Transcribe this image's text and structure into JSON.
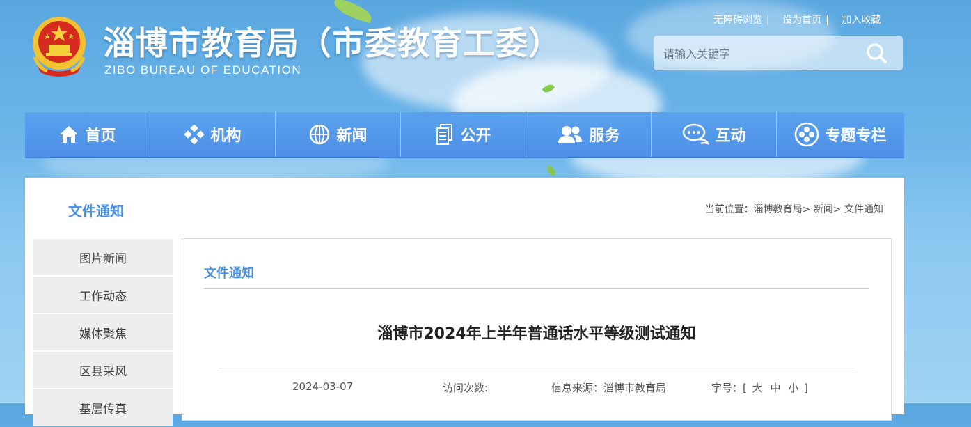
{
  "header": {
    "title": "淄博市教育局（市委教育工委）",
    "subtitle": "ZIBO BUREAU OF EDUCATION",
    "top_links": [
      "无障碍浏览",
      "设为首页",
      "加入收藏"
    ],
    "search_placeholder": "请输入关键字"
  },
  "nav": {
    "items": [
      {
        "label": "首页",
        "icon": "home-icon"
      },
      {
        "label": "机构",
        "icon": "organization-icon"
      },
      {
        "label": "新闻",
        "icon": "globe-icon"
      },
      {
        "label": "公开",
        "icon": "documents-icon"
      },
      {
        "label": "服务",
        "icon": "users-icon"
      },
      {
        "label": "互动",
        "icon": "chat-icon"
      },
      {
        "label": "专题专栏",
        "icon": "topics-icon"
      }
    ]
  },
  "page": {
    "category_title": "文件通知",
    "breadcrumb": "当前位置：淄博教育局> 新闻> 文件通知"
  },
  "sidebar": {
    "items": [
      "图片新闻",
      "工作动态",
      "媒体聚焦",
      "区县采风",
      "基层传真"
    ]
  },
  "article": {
    "category": "文件通知",
    "title": "淄博市2024年上半年普通话水平等级测试通知",
    "date": "2024-03-07",
    "visits_label": "访问次数:",
    "source": "信息来源：淄博市教育局",
    "font_size_label": "字号：[",
    "font_size_large": "大",
    "font_size_medium": "中",
    "font_size_small": "小",
    "font_size_close": "]"
  },
  "colors": {
    "accent": "#4a90e2",
    "nav_bg": "#5aa2ee",
    "sidebar_bg": "#eeeeee"
  }
}
